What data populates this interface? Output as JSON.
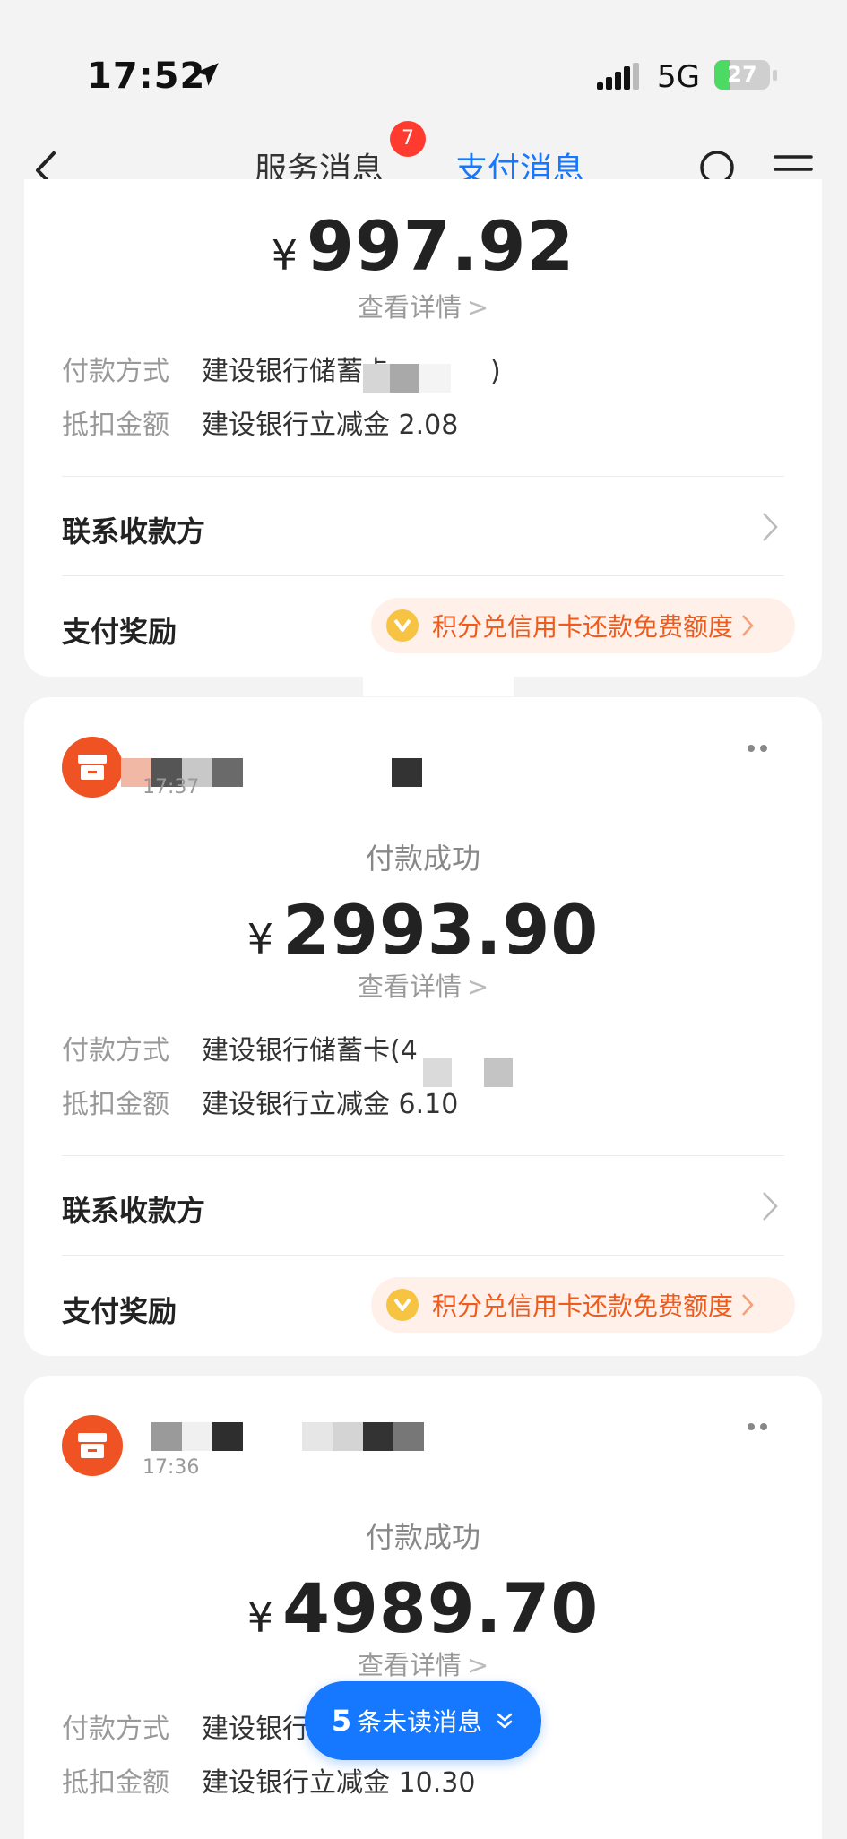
{
  "status_bar": {
    "time": "17:52",
    "network": "5G",
    "battery_percent": 27,
    "battery_label": "27"
  },
  "nav": {
    "tabs": [
      {
        "label": "服务消息",
        "badge": "7"
      },
      {
        "label": "支付消息",
        "active": true
      }
    ],
    "icons": [
      "back-icon",
      "search-icon",
      "menu-icon"
    ]
  },
  "messages": [
    {
      "amount": "997.92",
      "currency": "¥",
      "detail_link": "查看详情",
      "payment_method_label": "付款方式",
      "payment_method_value": "建设银行储蓄卡",
      "payment_method_suffix": ")",
      "deduction_label": "抵扣金额",
      "deduction_value": "建设银行立减金 2.08",
      "contact_label": "联系收款方",
      "reward_label": "支付奖励",
      "reward_text": "积分兑信用卡还款免费额度"
    },
    {
      "merchant_name": "",
      "merchant_time": "17:37",
      "status": "付款成功",
      "amount": "2993.90",
      "currency": "¥",
      "detail_link": "查看详情",
      "payment_method_label": "付款方式",
      "payment_method_value": "建设银行储蓄卡(4",
      "deduction_label": "抵扣金额",
      "deduction_value": "建设银行立减金 6.10",
      "contact_label": "联系收款方",
      "reward_label": "支付奖励",
      "reward_text": "积分兑信用卡还款免费额度"
    },
    {
      "merchant_name": "",
      "merchant_time": "17:36",
      "status": "付款成功",
      "amount": "4989.70",
      "currency": "¥",
      "detail_link": "查看详情",
      "payment_method_label": "付款方式",
      "payment_method_value": "建设银行",
      "deduction_label": "抵扣金额",
      "deduction_value": "建设银行立减金 10.30"
    }
  ],
  "unread": {
    "count": "5",
    "label": "条未读消息"
  },
  "colors": {
    "accent": "#1677ff",
    "badge": "#ff3b2f",
    "merchant": "#f05323",
    "reward": "#f05a1a"
  }
}
